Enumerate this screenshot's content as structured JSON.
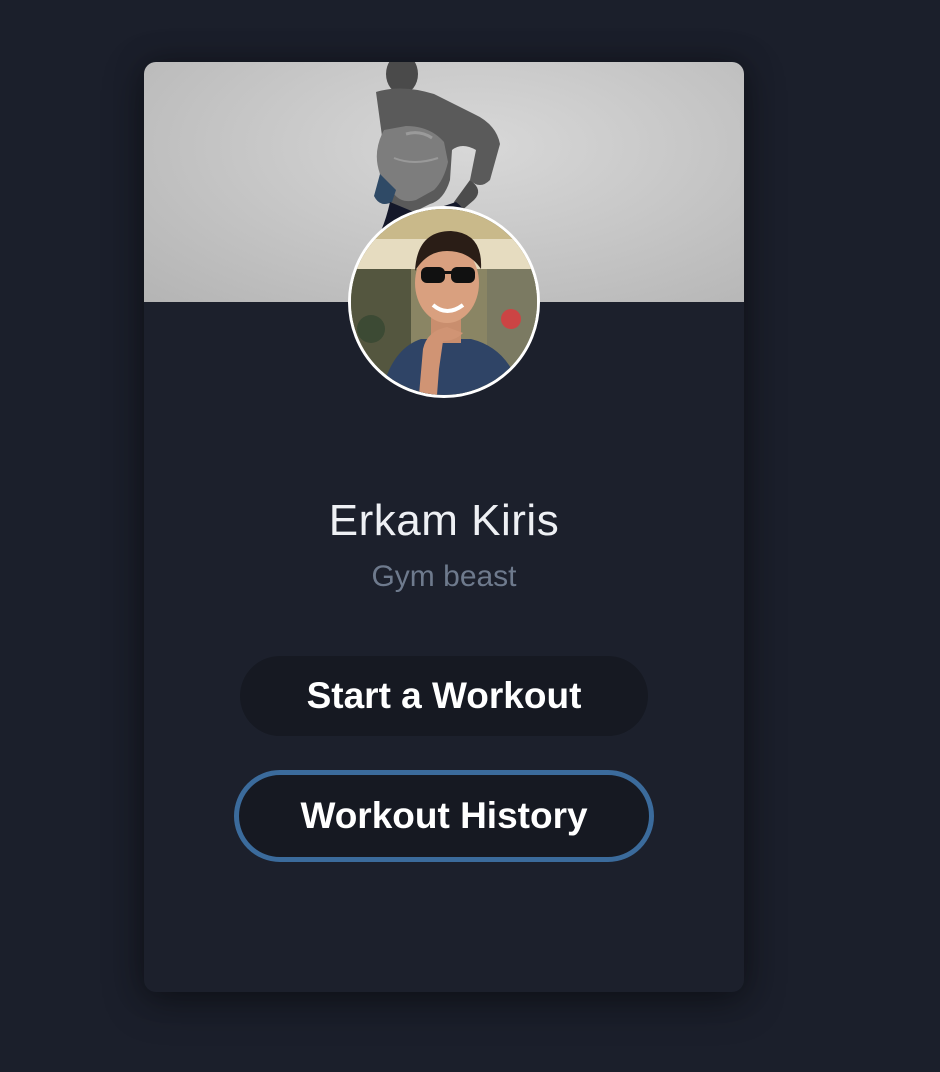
{
  "profile": {
    "name": "Erkam Kiris",
    "tagline": "Gym beast"
  },
  "actions": {
    "start_workout_label": "Start a Workout",
    "workout_history_label": "Workout History"
  },
  "colors": {
    "background": "#1b1f2b",
    "card": "#1c202c",
    "button": "#161922",
    "button_outline": "#3b6b9c",
    "tagline": "#6e7a8d"
  },
  "images": {
    "cover": "gym-athlete-cover-photo",
    "avatar": "user-profile-photo"
  }
}
